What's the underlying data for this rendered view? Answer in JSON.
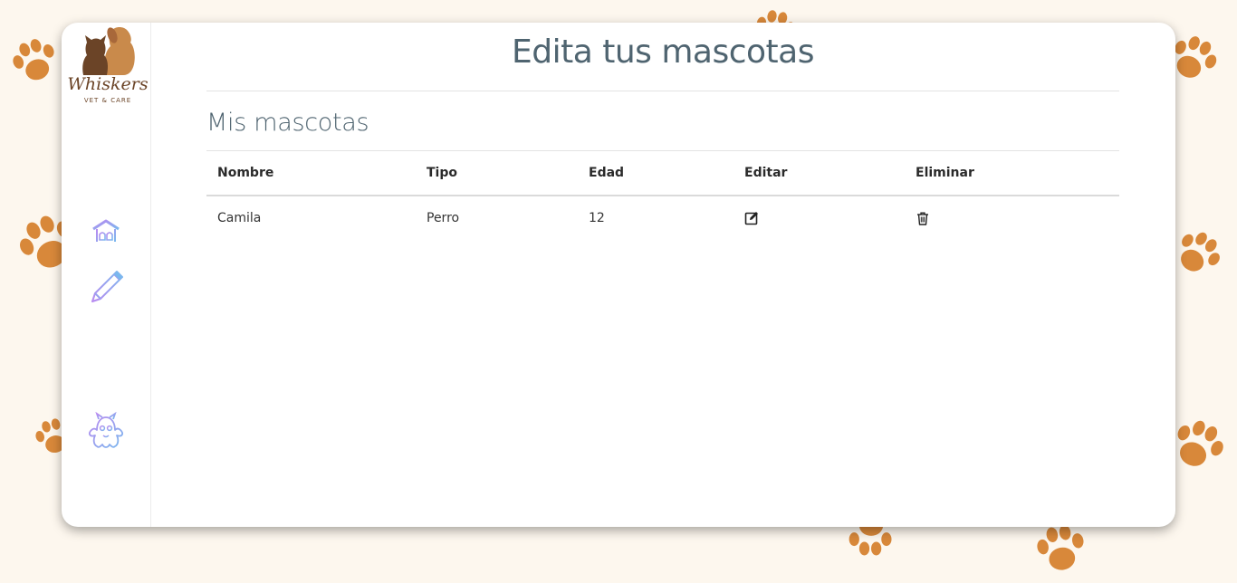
{
  "brand": {
    "name": "Whiskers",
    "tagline": "VET & CARE",
    "colors": {
      "brown": "#6b4427",
      "orange": "#d8883a",
      "background": "#fdf7ee"
    }
  },
  "sidebar": {
    "items": [
      {
        "icon": "home-icon"
      },
      {
        "icon": "pencil-icon"
      },
      {
        "icon": "monster-icon"
      }
    ]
  },
  "page": {
    "title": "Edita tus mascotas",
    "section_title": "Mis mascotas"
  },
  "table": {
    "headers": [
      "Nombre",
      "Tipo",
      "Edad",
      "Editar",
      "Eliminar"
    ],
    "rows": [
      {
        "nombre": "Camila",
        "tipo": "Perro",
        "edad": "12",
        "edit_icon": "edit-icon",
        "delete_icon": "trash-icon"
      }
    ]
  }
}
